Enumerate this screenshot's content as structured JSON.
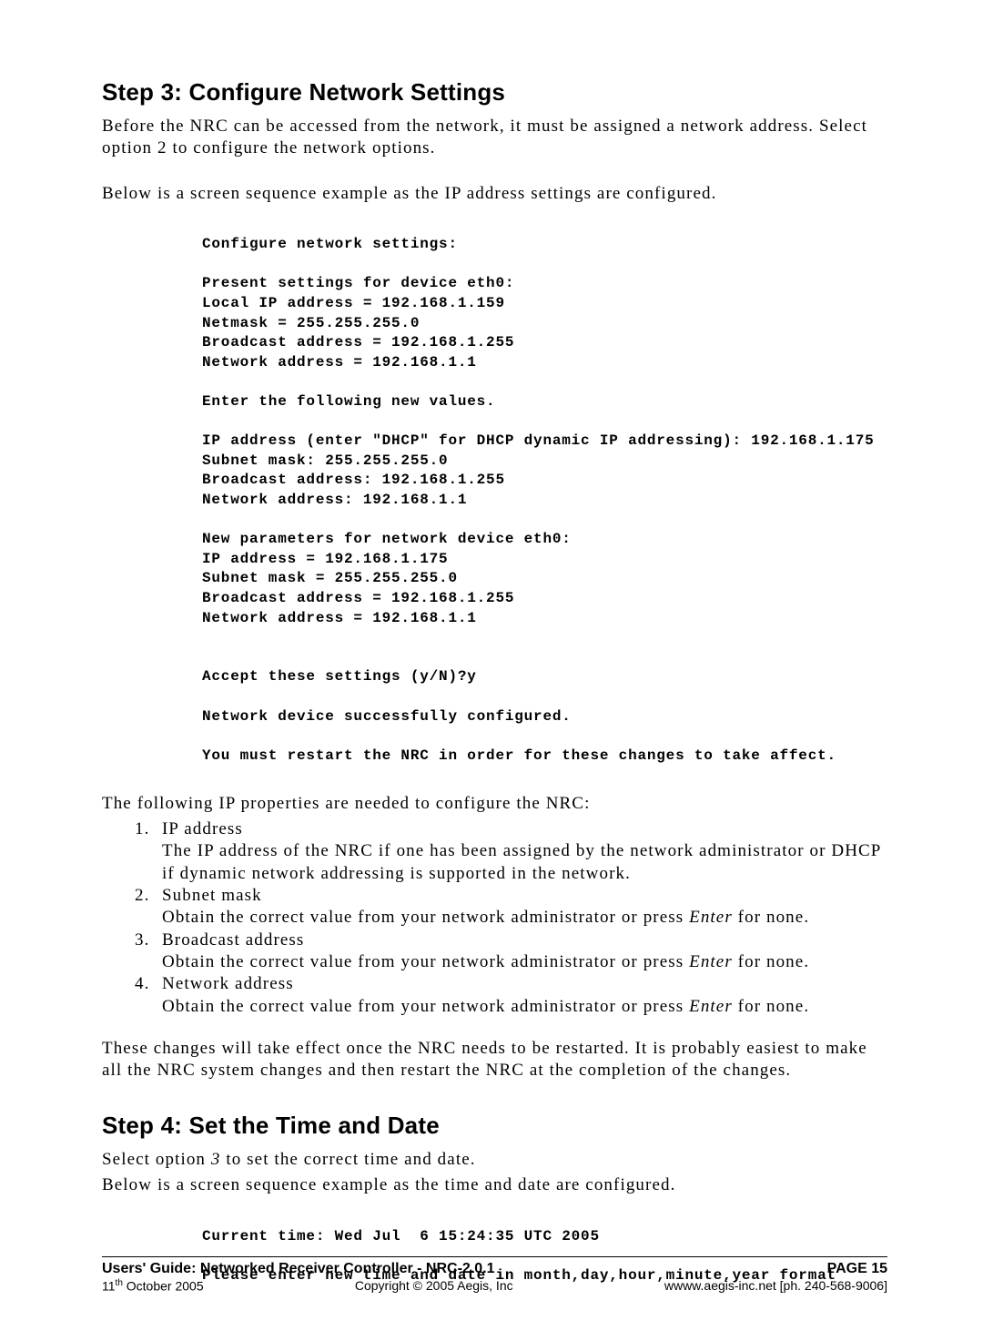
{
  "step3": {
    "heading": "Step 3:   Configure Network Settings",
    "para1": "Before the NRC can be accessed from the network, it must be assigned a network address.  Select option 2 to configure the network options.",
    "para2": "Below is a screen sequence example as the IP address settings are configured.",
    "console": "Configure network settings:\n\nPresent settings for device eth0:\nLocal IP address = 192.168.1.159\nNetmask = 255.255.255.0\nBroadcast address = 192.168.1.255\nNetwork address = 192.168.1.1\n\nEnter the following new values.\n\nIP address (enter \"DHCP\" for DHCP dynamic IP addressing): 192.168.1.175\nSubnet mask: 255.255.255.0\nBroadcast address: 192.168.1.255\nNetwork address: 192.168.1.1\n\nNew parameters for network device eth0:\nIP address = 192.168.1.175\nSubnet mask = 255.255.255.0\nBroadcast address = 192.168.1.255\nNetwork address = 192.168.1.1\n\n\nAccept these settings (y/N)?y\n\nNetwork device successfully configured.\n\nYou must restart the NRC in order for these changes to take affect.",
    "props_intro": "The following IP properties are needed to configure the NRC:",
    "items": [
      {
        "num": "1.",
        "title": "IP address",
        "desc": "The IP address of the NRC if one has been assigned by the network administrator or  DHCP  if dynamic network addressing is supported in the network."
      },
      {
        "num": "2.",
        "title": "Subnet mask",
        "desc_pre": "Obtain the correct value from your network administrator or press ",
        "desc_em": "Enter",
        "desc_post": " for none."
      },
      {
        "num": "3.",
        "title": "Broadcast address",
        "desc_pre": "Obtain the correct value from your network administrator or press ",
        "desc_em": "Enter",
        "desc_post": " for none."
      },
      {
        "num": "4.",
        "title": "Network address",
        "desc_pre": "Obtain the correct value from your network administrator or press ",
        "desc_em": "Enter",
        "desc_post": " for none."
      }
    ],
    "para3": "These changes will take effect once the NRC needs to be restarted. It is probably easiest to make all the NRC system changes and then restart the NRC at the completion of the changes."
  },
  "step4": {
    "heading": "Step 4:   Set the Time and Date",
    "para1_pre": "Select option ",
    "para1_em": "3",
    "para1_post": " to set the correct time and date.",
    "para2": "Below is a screen sequence example as the time and date are configured.",
    "console": "Current time: Wed Jul  6 15:24:35 UTC 2005\n\nPlease enter new time and date in month,day,hour,minute,year format"
  },
  "footer": {
    "title": "Users' Guide: Networked Receiver Controller - NRC-2.0.1",
    "page": "PAGE 15",
    "date_pre": "11",
    "date_sup": "th",
    "date_post": " October 2005",
    "copyright": "Copyright © 2005 Aegis, Inc",
    "contact": "wwww.aegis-inc.net [ph. 240-568-9006]"
  }
}
